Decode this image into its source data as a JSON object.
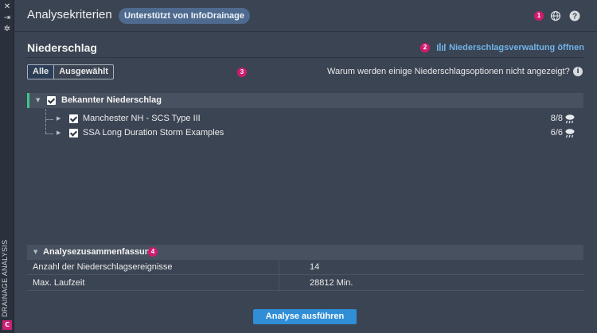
{
  "sidebar": {
    "label": "DRAINAGE ANALYSIS",
    "app_icon_text": "C"
  },
  "header": {
    "title": "Analysekriterien",
    "badge": "Unterstützt von InfoDrainage",
    "marker_1": "1"
  },
  "section": {
    "title": "Niederschlag",
    "marker_2": "2",
    "manage_link": "Niederschlagsverwaltung öffnen"
  },
  "filter": {
    "options": [
      "Alle",
      "Ausgewählt"
    ],
    "selected": "Alle",
    "marker_3": "3",
    "question": "Warum werden einige Niederschlagsoptionen nicht angezeigt?"
  },
  "tree": {
    "group_label": "Bekannter Niederschlag",
    "group_checked": true,
    "items": [
      {
        "label": "Manchester NH - SCS Type III",
        "count": "8/8",
        "checked": true
      },
      {
        "label": "SSA Long Duration Storm Examples",
        "count": "6/6",
        "checked": true
      }
    ]
  },
  "summary": {
    "title": "Analysezusammenfassung",
    "marker_4": "4",
    "rows": [
      {
        "key": "Anzahl der Niederschlagsereignisse",
        "value": "14"
      },
      {
        "key": "Max. Laufzeit",
        "value": "28812 Min."
      }
    ]
  },
  "actions": {
    "run_label": "Analyse ausführen"
  },
  "colors": {
    "accent": "#2f8ed6",
    "link": "#6fb3e8",
    "marker": "#d01b6e",
    "group_bar": "#3fc58a",
    "background": "#3b4453"
  }
}
